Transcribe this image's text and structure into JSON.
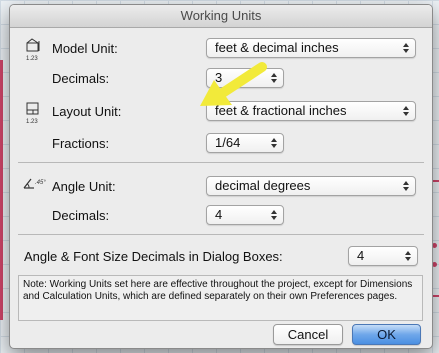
{
  "window": {
    "title": "Working Units"
  },
  "model_unit": {
    "label": "Model Unit:",
    "value": "feet & decimal inches",
    "icon": "model-unit-icon"
  },
  "model_decimals": {
    "label": "Decimals:",
    "value": "3"
  },
  "layout_unit": {
    "label": "Layout Unit:",
    "value": "feet & fractional inches",
    "icon": "layout-unit-icon"
  },
  "fractions": {
    "label": "Fractions:",
    "value": "1/64"
  },
  "angle_unit": {
    "label": "Angle Unit:",
    "value": "decimal degrees",
    "icon": "angle-unit-icon"
  },
  "angle_decimals": {
    "label": "Decimals:",
    "value": "4"
  },
  "dialog_decimals": {
    "label": "Angle & Font Size Decimals in Dialog Boxes:",
    "value": "4"
  },
  "icon_caption": "1.23",
  "note": "Note: Working Units set here are effective throughout the project, except for Dimensions and Calculation Units, which are defined separately on their own Preferences pages.",
  "buttons": {
    "cancel": "Cancel",
    "ok": "OK"
  },
  "colors": {
    "annotation_arrow": "#f2ea3a",
    "accent": "#4b8fe2"
  }
}
